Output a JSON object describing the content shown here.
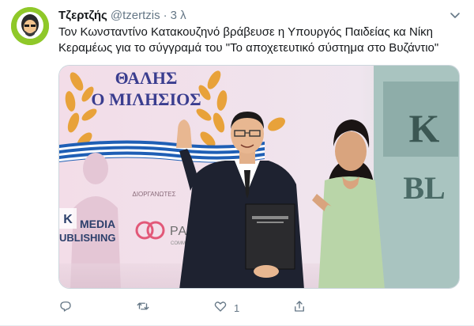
{
  "tweet": {
    "display_name": "Τζερτζής",
    "handle": "@tzertzis",
    "separator": "·",
    "time": "3 λ",
    "text": "Τον Κωνσταντίνο Κατακουζηνό βράβευσε η Υπουργός Παιδείας κα Νίκη Κεραμέως για το σύγγραμά του \"Το αποχετευτικό σύστημα στο Βυζάντιο\"",
    "likes_count": "1"
  },
  "media": {
    "banner_line1": "ΘΑΛΗΣ",
    "banner_line2": "Ο ΜΙΛΗΣΙΟΣ",
    "organizers_label": "ΔΙΟΡΓΑΝΩΤΕΣ",
    "sponsor_media": "MEDIA",
    "sponsor_publishing": "UBLISHING",
    "sponsor_k": "K",
    "sponsor_palla": "PALLA",
    "sponsor_palla_sub": "COMMUNICATI",
    "backdrop_letters": [
      "K",
      "BL"
    ],
    "colors": {
      "backdrop_pink": "#f1d9e6",
      "laurel_gold": "#e8a23a",
      "flag_blue": "#1f5fb5",
      "dress_green": "#b9d5a8",
      "suit_dark": "#1e2230"
    }
  },
  "icons": [
    "reply-icon",
    "retweet-icon",
    "like-icon",
    "share-icon",
    "caret-down-icon"
  ]
}
